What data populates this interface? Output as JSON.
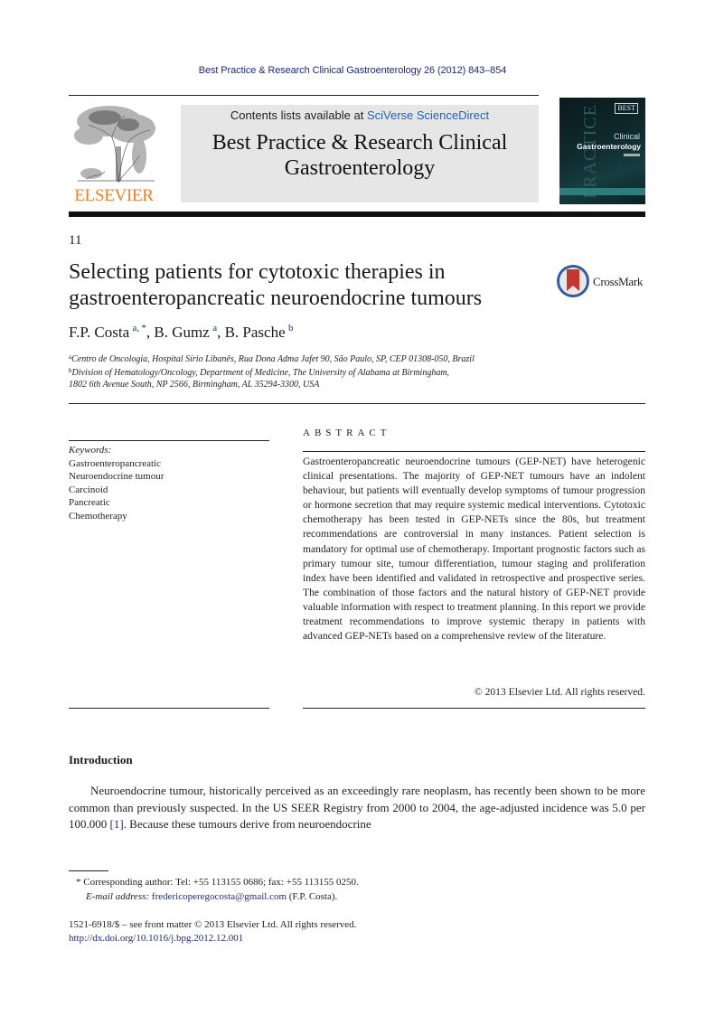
{
  "header": {
    "journal_reference": "Best Practice & Research Clinical Gastroenterology 26 (2012) 843–854",
    "contents_prefix": "Contents lists available at ",
    "contents_link": "SciVerse ScienceDirect",
    "journal_title_line1": "Best Practice & Research Clinical",
    "journal_title_line2": "Gastroenterology",
    "publisher_logo_text": "ELSEVIER",
    "cover": {
      "badge": "BEST",
      "subtitle": "Clinical",
      "title": "Gastroenterology",
      "vertical_text": "PRACTICE"
    }
  },
  "article": {
    "number": "11",
    "title_line1": "Selecting patients for cytotoxic therapies in",
    "title_line2": "gastroenteropancreatic neuroendocrine tumours",
    "crossmark_label": "CrossMark",
    "authors": [
      {
        "name": "F.P. Costa",
        "sup": "a, *"
      },
      {
        "name": "B. Gumz",
        "sup": "a"
      },
      {
        "name": "B. Pasche",
        "sup": "b"
      }
    ],
    "affiliations": [
      {
        "marker": "a",
        "text": "Centro de Oncologia, Hospital Sírio Libanês, Rua Dona Adma Jafet 90, São Paulo, SP, CEP 01308-050, Brazil"
      },
      {
        "marker": "b",
        "text": "Division of Hematology/Oncology, Department of Medicine, The University of Alabama at Birmingham,"
      },
      {
        "marker": "",
        "text": "1802 6th Avenue South, NP 2566, Birmingham, AL 35294-3300, USA"
      }
    ]
  },
  "keywords": {
    "heading": "Keywords:",
    "items": [
      "Gastroenteropancreatic",
      "Neuroendocrine tumour",
      "Carcinoid",
      "Pancreatic",
      "Chemotherapy"
    ]
  },
  "abstract": {
    "heading": "ABSTRACT",
    "text": "Gastroenteropancreatic neuroendocrine tumours (GEP-NET) have heterogenic clinical presentations. The majority of GEP-NET tumours have an indolent behaviour, but patients will eventually develop symptoms of tumour progression or hormone secretion that may require systemic medical interventions. Cytotoxic che­motherapy has been tested in GEP-NETs since the 80s, but treat­ment recommendations are controversial in many instances. Patient selection is mandatory for optimal use of chemotherapy. Important prognostic factors such as primary tumour site, tumour differentiation, tumour staging and proliferation index have been identified and validated in retrospective and prospective series. The combination of those factors and the natural history of GEP-NET provide valuable information with respect to treatment planning. In this report we provide treatment recommendations to improve systemic therapy in patients with advanced GEP-NETs based on a comprehensive review of the literature.",
    "copyright": "© 2013 Elsevier Ltd. All rights reserved."
  },
  "introduction": {
    "heading": "Introduction",
    "text_before_ref": "Neuroendocrine tumour, historically perceived as an exceedingly rare neoplasm, has recently been shown to be more common than previously suspected. In the US SEER Registry from 2000 to 2004, the age-adjusted incidence was 5.0 per 100.000 ",
    "ref": "[1]",
    "text_after_ref": ". Because these tumours derive from neuroendocrine"
  },
  "footnotes": {
    "corresponding": "* Corresponding author: Tel: +55 113155 0686; fax: +55 113155 0250.",
    "email_label": "E-mail address:",
    "email": "fredericoperegocosta@gmail.com",
    "email_suffix": " (F.P. Costa).",
    "front_matter": "1521-6918/$ – see front matter © 2013 Elsevier Ltd. All rights reserved.",
    "doi": "http://dx.doi.org/10.1016/j.bpg.2012.12.001"
  },
  "colors": {
    "link": "#1e2a78",
    "sciencedirect": "#1e64b4",
    "elsevier_orange": "#f07f1c",
    "banner_bg": "#e6e6e6"
  }
}
